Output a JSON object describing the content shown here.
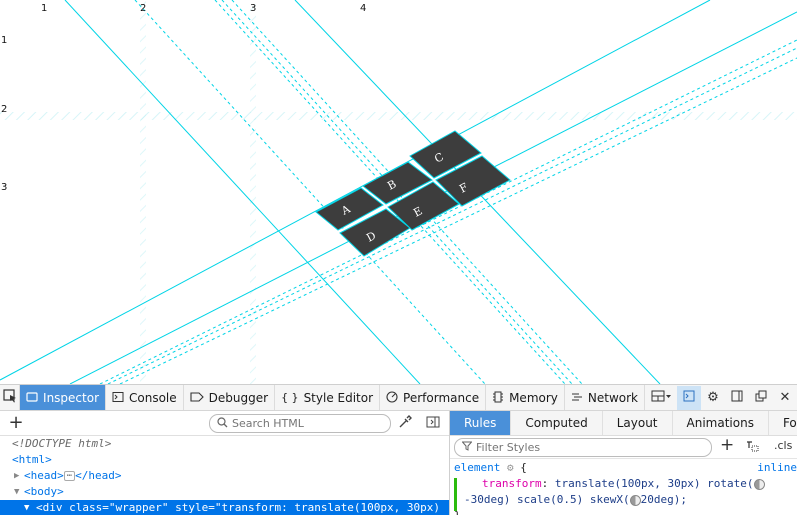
{
  "grid": {
    "col_numbers": [
      "1",
      "2",
      "3",
      "4"
    ],
    "row_numbers": [
      "1",
      "2",
      "3"
    ],
    "cells": [
      "A",
      "B",
      "C",
      "D",
      "E",
      "F"
    ],
    "colors": {
      "grid_line": "#00d4e6",
      "cell_bg": "#3d3d3d",
      "cell_text": "#ffffff"
    }
  },
  "toolbar": {
    "tabs": [
      {
        "label": "Inspector",
        "icon": "inspector-icon"
      },
      {
        "label": "Console",
        "icon": "console-icon"
      },
      {
        "label": "Debugger",
        "icon": "debugger-icon"
      },
      {
        "label": "Style Editor",
        "icon": "style-editor-icon"
      },
      {
        "label": "Performance",
        "icon": "performance-icon"
      },
      {
        "label": "Memory",
        "icon": "memory-icon"
      },
      {
        "label": "Network",
        "icon": "network-icon"
      }
    ],
    "active_tab": "Inspector"
  },
  "markup": {
    "search_placeholder": "Search HTML",
    "lines": {
      "doctype": "<!DOCTYPE html>",
      "html_open": "<html>",
      "head_open": "<head>",
      "head_ellipsis": "⋯",
      "head_close": "</head>",
      "body_open": "<body>",
      "div_tag": "<div",
      "div_attr1_name": "class=",
      "div_attr1_val": "\"wrapper\"",
      "div_attr2_name": "style=",
      "div_attr2_val": "\"transform: translate(100px, 30px)"
    }
  },
  "rules": {
    "tabs": [
      "Rules",
      "Computed",
      "Layout",
      "Animations",
      "Fo"
    ],
    "active_tab": "Rules",
    "filter_placeholder": "Filter Styles",
    "cls_label": ".cls",
    "selector": "element",
    "brace_open": "{",
    "source": "inline",
    "property": "transform",
    "value_part1": "translate(100px, 30px) rotate(",
    "value_part2": "-30deg) scale(0.5) skewX(",
    "value_part3": "20deg);",
    "brace_close": "}"
  }
}
